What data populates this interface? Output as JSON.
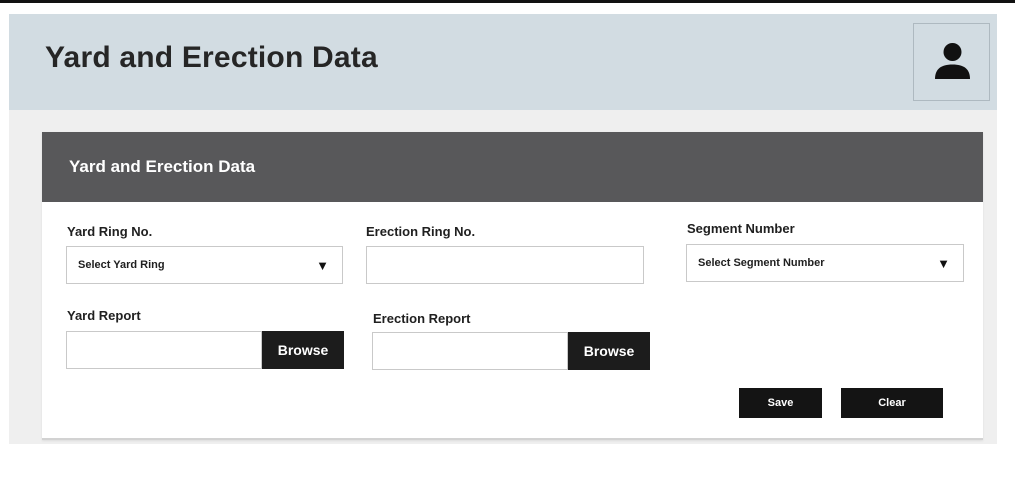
{
  "header": {
    "title": "Yard and Erection Data",
    "user_icon": "user-icon"
  },
  "panel": {
    "title": "Yard and Erection Data"
  },
  "form": {
    "yard_ring": {
      "label": "Yard Ring No.",
      "value": "Select  Yard Ring",
      "caret_icon": "caret-down-icon"
    },
    "erection_ring": {
      "label": "Erection Ring No.",
      "value": ""
    },
    "segment": {
      "label": "Segment Number",
      "value": "Select  Segment Number",
      "caret_icon": "caret-down-icon"
    },
    "yard_report": {
      "label": "Yard Report",
      "value": "",
      "browse_label": "Browse"
    },
    "erection_report": {
      "label": "Erection Report",
      "value": "",
      "browse_label": "Browse"
    }
  },
  "actions": {
    "save_label": "Save",
    "clear_label": "Clear"
  },
  "colors": {
    "header_bg": "#d2dce2",
    "panel_header_bg": "#58585a",
    "button_bg": "#1c1c1c"
  }
}
